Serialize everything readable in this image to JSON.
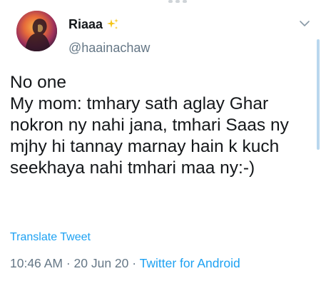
{
  "tweet": {
    "display_name": "Riaaa",
    "handle": "@haainachaw",
    "text": "No one\nMy mom: tmhary sath aglay Ghar nokron ny nahi jana, tmhari Saas ny mjhy hi tannay marnay hain k kuch seekhaya nahi tmhari maa ny:-)",
    "translate_label": "Translate Tweet",
    "time": "10:46 AM",
    "separator": "·",
    "date": "20 Jun 20",
    "source": "Twitter for Android"
  },
  "icons": {
    "name_badge": "sparkles-icon",
    "menu": "chevron-down-icon"
  },
  "colors": {
    "link": "#1da1f2",
    "secondary_text": "#657786",
    "primary_text": "#14171a",
    "sparkle": "#f5c518"
  }
}
